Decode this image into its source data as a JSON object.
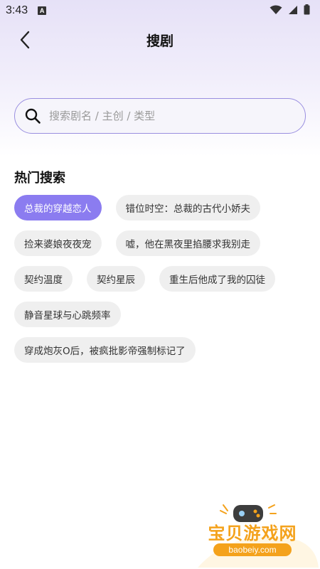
{
  "status_bar": {
    "time": "3:43",
    "notification_badge": "A",
    "icons": [
      "wifi-icon",
      "signal-icon",
      "battery-icon"
    ]
  },
  "header": {
    "title": "搜剧",
    "back_icon": "chevron-left-icon"
  },
  "search": {
    "placeholder": "搜索剧名 / 主创 / 类型",
    "value": ""
  },
  "hot_search": {
    "title": "热门搜索",
    "tags": [
      {
        "label": "总裁的穿越恋人",
        "active": true
      },
      {
        "label": "错位时空：总裁的古代小娇夫",
        "active": false
      },
      {
        "label": "捡来婆娘夜夜宠",
        "active": false
      },
      {
        "label": "嘘，他在黑夜里掐腰求我别走",
        "active": false
      },
      {
        "label": "契约温度",
        "active": false
      },
      {
        "label": "契约星辰",
        "active": false
      },
      {
        "label": "重生后他成了我的囚徒",
        "active": false
      },
      {
        "label": "静音星球与心跳频率",
        "active": false
      },
      {
        "label": "穿成炮灰O后，被疯批影帝强制标记了",
        "active": false
      }
    ]
  },
  "watermark": {
    "title": "宝贝游戏网",
    "url": "baobeiy.com"
  },
  "colors": {
    "accent": "#8b7cf0",
    "search_border": "#9a8fe0",
    "tag_bg": "#efefef",
    "watermark": "#f4a21c"
  }
}
